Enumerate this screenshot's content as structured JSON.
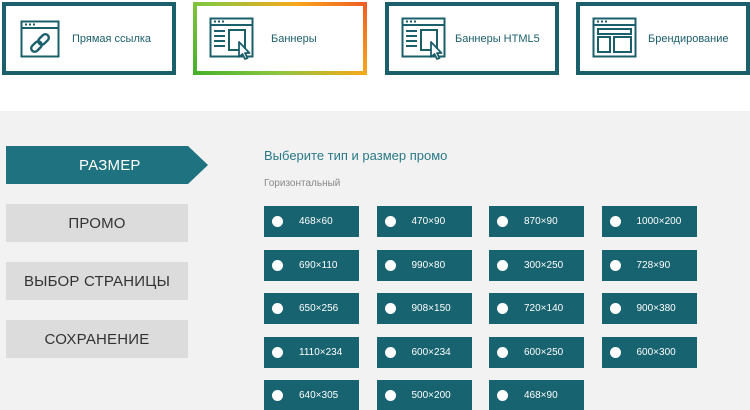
{
  "tabs": [
    {
      "label": "Прямая ссылка",
      "icon": "link-icon"
    },
    {
      "label": "Баннеры",
      "icon": "banner-icon"
    },
    {
      "label": "Баннеры HTML5",
      "icon": "html5-banner-icon"
    },
    {
      "label": "Брендирование",
      "icon": "branding-icon"
    }
  ],
  "active_tab": "Баннеры",
  "steps": [
    "РАЗМЕР",
    "ПРОМО",
    "ВЫБОР СТРАНИЦЫ",
    "СОХРАНЕНИЕ"
  ],
  "active_step": "РАЗМЕР",
  "content": {
    "title": "Выберите тип и размер промо",
    "subtitle": "Горизонтальный"
  },
  "sizes": [
    "468×60",
    "470×90",
    "870×90",
    "1000×200",
    "690×110",
    "990×80",
    "300×250",
    "728×90",
    "650×256",
    "908×150",
    "720×140",
    "900×380",
    "1110×234",
    "600×234",
    "600×250",
    "600×300",
    "640×305",
    "500×200",
    "468×90"
  ],
  "colors": {
    "primary": "#1b5f6b",
    "option_bg": "#17636f",
    "active_step": "#1f7381",
    "inactive_step": "#dcdcdc",
    "panel_bg": "#f2f2f2"
  }
}
